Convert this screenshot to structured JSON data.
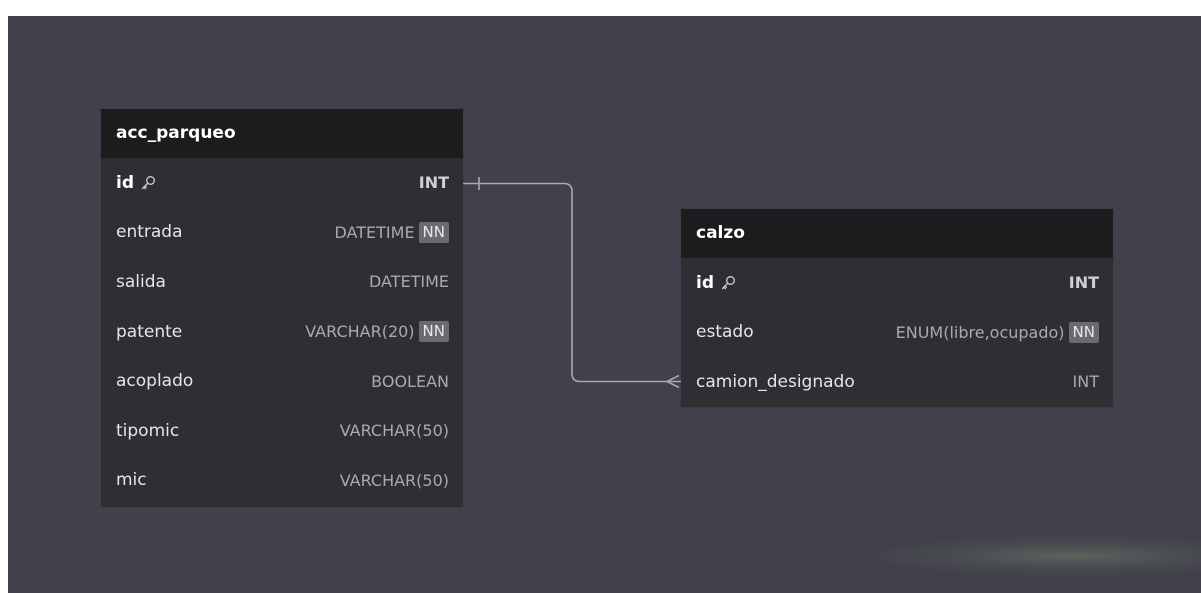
{
  "tables": {
    "acc_parqueo": {
      "title": "acc_parqueo",
      "rows": [
        {
          "name": "id",
          "type": "INT",
          "pk": true,
          "nn": ""
        },
        {
          "name": "entrada",
          "type": "DATETIME",
          "pk": false,
          "nn": "NN"
        },
        {
          "name": "salida",
          "type": "DATETIME",
          "pk": false,
          "nn": ""
        },
        {
          "name": "patente",
          "type": "VARCHAR(20)",
          "pk": false,
          "nn": "NN"
        },
        {
          "name": "acoplado",
          "type": "BOOLEAN",
          "pk": false,
          "nn": ""
        },
        {
          "name": "tipomic",
          "type": "VARCHAR(50)",
          "pk": false,
          "nn": ""
        },
        {
          "name": "mic",
          "type": "VARCHAR(50)",
          "pk": false,
          "nn": ""
        }
      ]
    },
    "calzo": {
      "title": "calzo",
      "rows": [
        {
          "name": "id",
          "type": "INT",
          "pk": true,
          "nn": ""
        },
        {
          "name": "estado",
          "type": "ENUM(libre,ocupado)",
          "pk": false,
          "nn": "NN"
        },
        {
          "name": "camion_designado",
          "type": "INT",
          "pk": false,
          "nn": ""
        }
      ]
    }
  },
  "relationship": {
    "from": "acc_parqueo.id",
    "to": "calzo.camion_designado",
    "from_cardinality": "one",
    "to_cardinality": "many"
  },
  "colors": {
    "canvas": "#42414b",
    "header": "#1c1c1e",
    "body": "#2e2e33",
    "connector": "#a8a8b0"
  },
  "icons": {
    "primary_key": "key-icon"
  }
}
